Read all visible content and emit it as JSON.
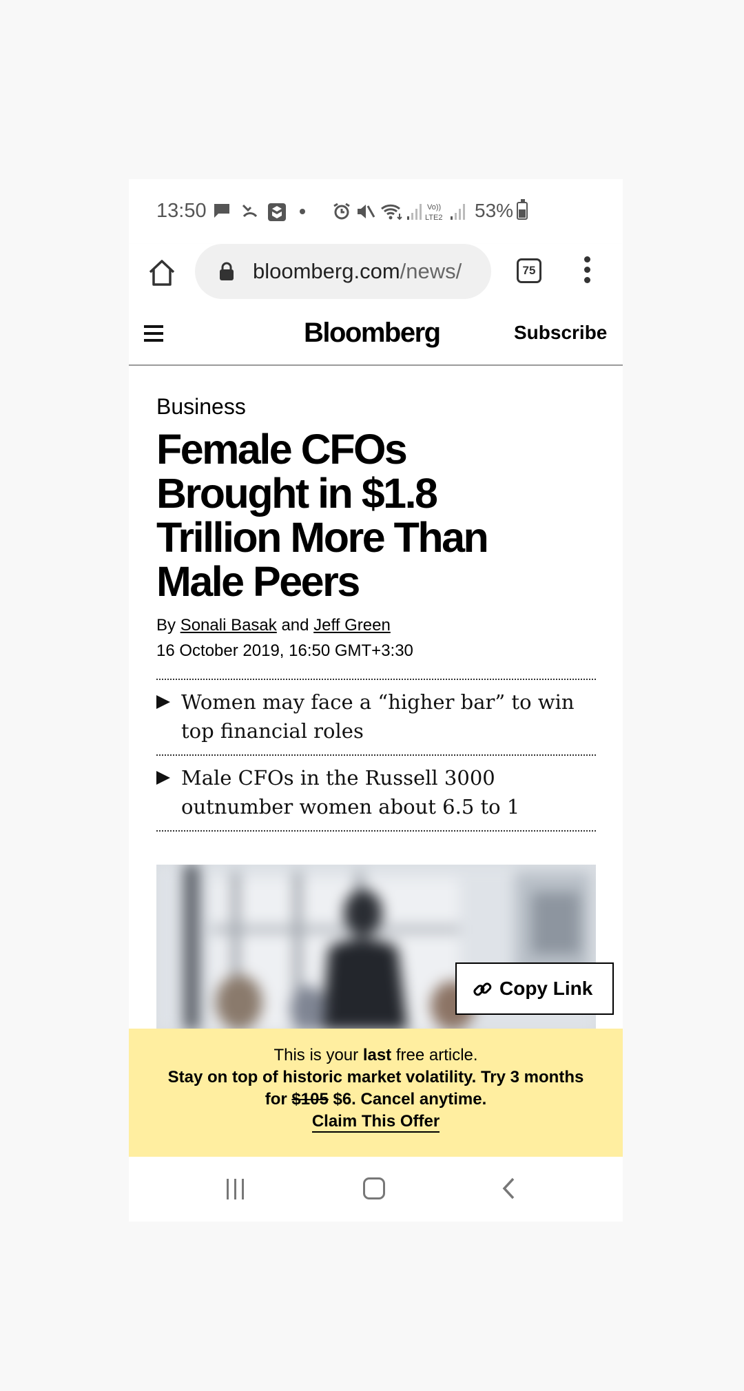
{
  "status_bar": {
    "time": "13:50",
    "battery": "53%",
    "icons": [
      "message-icon",
      "missed-call-icon",
      "app-icon",
      "dot-icon",
      "alarm-icon",
      "mute-icon",
      "wifi-icon",
      "signal-icon",
      "volte-icon",
      "signal-icon",
      "battery-icon"
    ],
    "volte_label": "VoLTE2"
  },
  "browser": {
    "url_domain": "bloomberg.com",
    "url_path": "/news/",
    "tab_count": "75"
  },
  "site_header": {
    "logo": "Bloomberg",
    "subscribe": "Subscribe"
  },
  "article": {
    "section": "Business",
    "headline": "Female CFOs Brought in $1.8 Trillion More Than Male Peers",
    "by_prefix": "By",
    "author1": "Sonali Basak",
    "and": "and",
    "author2": "Jeff Green",
    "date": "16 October 2019, 16:50 GMT+3:30",
    "bullets": [
      "Women may face a “higher bar” to win top financial roles",
      "Male CFOs in the Russell 3000 outnumber women about 6.5 to 1"
    ],
    "copy_link": "Copy Link"
  },
  "paywall": {
    "line1_pre": "This is your",
    "line1_bold": "last",
    "line1_post": "free article.",
    "line2": "Stay on top of historic market volatility. Try 3 months",
    "line3_pre": "for",
    "old_price": "$105",
    "line3_post": "$6. Cancel anytime.",
    "cta": "Claim This Offer"
  },
  "colors": {
    "paywall_bg": "#ffeea0",
    "url_bar_bg": "#f0f0f0"
  }
}
